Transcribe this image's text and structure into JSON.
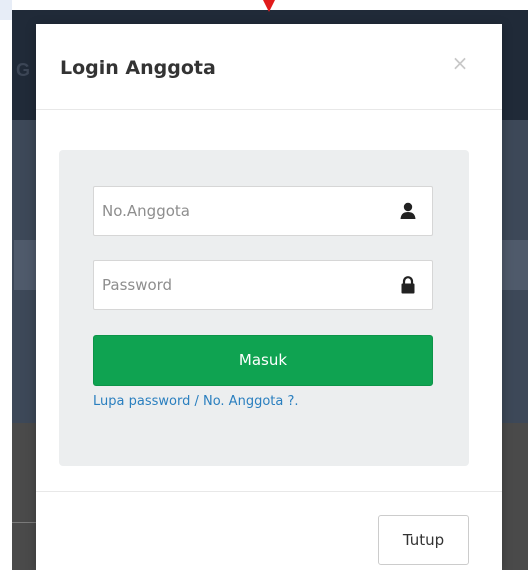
{
  "background": {
    "brand_fragment": "G"
  },
  "modal": {
    "title": "Login Anggota",
    "close_symbol": "×"
  },
  "form": {
    "member_number": {
      "value": "",
      "placeholder": "No.Anggota",
      "icon": "user-icon"
    },
    "password": {
      "value": "",
      "placeholder": "Password",
      "icon": "lock-icon"
    },
    "submit_label": "Masuk",
    "forgot_link": "Lupa password / No. Anggota ?."
  },
  "footer": {
    "close_label": "Tutup"
  },
  "colors": {
    "submit_button": "#0fa351",
    "link": "#2a7fbf",
    "login_box": "#eceeef",
    "backdrop_dark": "#202a38"
  }
}
